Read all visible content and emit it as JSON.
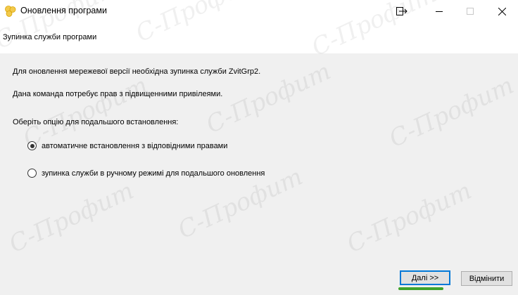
{
  "window": {
    "title": "Оновлення програми",
    "icon": "app-logo-icon",
    "controls": [
      "share-icon",
      "minimize-icon",
      "maximize-icon",
      "close-icon"
    ]
  },
  "header": {
    "subtitle": "Зупинка служби програми"
  },
  "main": {
    "info_line_1": "Для оновлення мережевої версії необхідна зупинка служби ZvitGrp2.",
    "info_line_2": "Дана команда потребує прав з підвищенними привілеями.",
    "prompt": "Оберіть опцію для подальшого встановлення:",
    "options": [
      {
        "label": "автоматичне встановлення з відповідними правами",
        "selected": true
      },
      {
        "label": "зупинка служби в ручному режимі для подальшого оновлення",
        "selected": false
      }
    ]
  },
  "footer": {
    "next_label": "Далі >>",
    "cancel_label": "Відмінити"
  },
  "watermark": {
    "text": "С-Профит"
  },
  "colors": {
    "content_bg": "#f0f0f0",
    "focus_border": "#0078d7",
    "highlight": "#3fa32b",
    "logo": "#f2c94c"
  }
}
